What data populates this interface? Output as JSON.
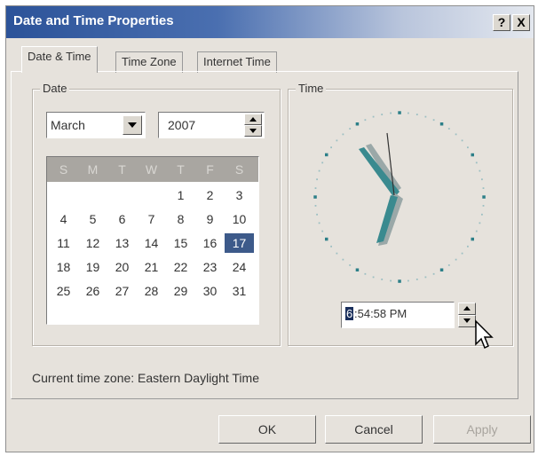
{
  "window": {
    "title": "Date and Time Properties",
    "help_label": "?",
    "close_label": "X"
  },
  "tabs": [
    {
      "label": "Date & Time",
      "active": true
    },
    {
      "label": "Time Zone",
      "active": false
    },
    {
      "label": "Internet Time",
      "active": false
    }
  ],
  "date_group": {
    "label": "Date",
    "month": "March",
    "year": "2007"
  },
  "calendar": {
    "weekdays": [
      "S",
      "M",
      "T",
      "W",
      "T",
      "F",
      "S"
    ],
    "weeks": [
      [
        "",
        "",
        "",
        "",
        "1",
        "2",
        "3"
      ],
      [
        "4",
        "5",
        "6",
        "7",
        "8",
        "9",
        "10"
      ],
      [
        "11",
        "12",
        "13",
        "14",
        "15",
        "16",
        "17"
      ],
      [
        "18",
        "19",
        "20",
        "21",
        "22",
        "23",
        "24"
      ],
      [
        "25",
        "26",
        "27",
        "28",
        "29",
        "30",
        "31"
      ]
    ],
    "selected_day": "17"
  },
  "time_group": {
    "label": "Time",
    "time_highlight": "6",
    "time_rest": ":54:58 PM"
  },
  "timezone": {
    "text": "Current time zone:  Eastern Daylight Time"
  },
  "buttons": {
    "ok": "OK",
    "cancel": "Cancel",
    "apply": "Apply"
  },
  "colors": {
    "title_bar": "#2c5399",
    "clock_hand": "#3a8a8f",
    "clock_dot": "#2c7f88",
    "selected_day": "#3d5a8a"
  }
}
